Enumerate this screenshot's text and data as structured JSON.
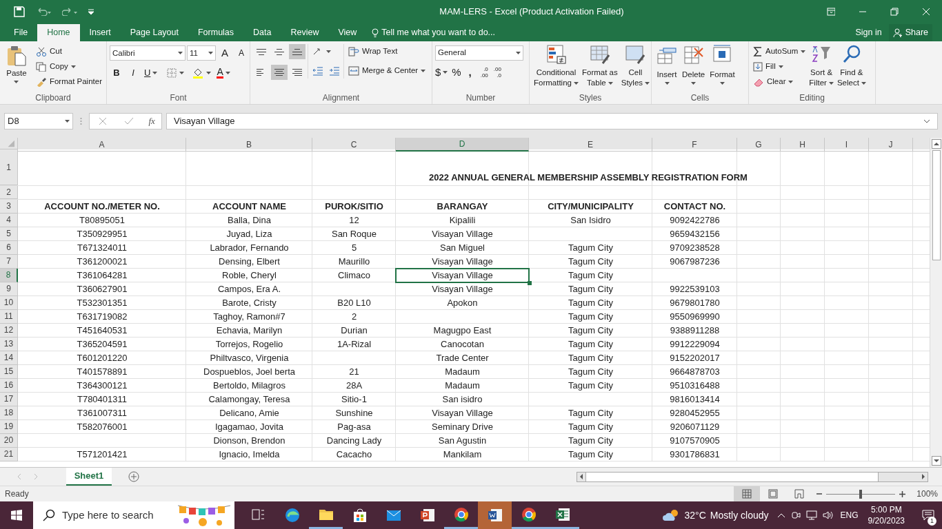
{
  "window": {
    "title": "MAM-LERS - Excel (Product Activation Failed)"
  },
  "ribbon_tabs": [
    {
      "label": "File",
      "selected": false
    },
    {
      "label": "Home",
      "selected": true
    },
    {
      "label": "Insert",
      "selected": false
    },
    {
      "label": "Page Layout",
      "selected": false
    },
    {
      "label": "Formulas",
      "selected": false
    },
    {
      "label": "Data",
      "selected": false
    },
    {
      "label": "Review",
      "selected": false
    },
    {
      "label": "View",
      "selected": false
    }
  ],
  "tell_me": {
    "placeholder": "Tell me what you want to do..."
  },
  "sign_in": "Sign in",
  "share": "Share",
  "clipboard": {
    "label": "Clipboard",
    "paste": "Paste",
    "cut": "Cut",
    "copy": "Copy",
    "format_painter": "Format Painter"
  },
  "font": {
    "label": "Font",
    "name": "Calibri",
    "size": "11",
    "grow": "A",
    "shrink": "A",
    "bold": "B",
    "italic": "I",
    "underline": "U",
    "font_color_label": "A"
  },
  "alignment": {
    "label": "Alignment",
    "vertical": [
      {
        "kind": "top",
        "selected": false
      },
      {
        "kind": "middle",
        "selected": false
      },
      {
        "kind": "bottom",
        "selected": true
      }
    ],
    "horizontal": [
      {
        "kind": "left",
        "selected": false
      },
      {
        "kind": "center",
        "selected": true
      },
      {
        "kind": "right",
        "selected": false
      }
    ],
    "wrap_text": "Wrap Text",
    "merge_center": "Merge & Center"
  },
  "number": {
    "label": "Number",
    "format": "General",
    "currency": "$",
    "percent": "%",
    "comma": ",",
    "increase_decimal": [
      ".0",
      ".00"
    ],
    "decrease_decimal": [
      ".00",
      ".0"
    ]
  },
  "styles": {
    "label": "Styles",
    "buttons": [
      {
        "kind": "conditional",
        "lines": [
          "Conditional",
          "Formatting"
        ]
      },
      {
        "kind": "table",
        "lines": [
          "Format as",
          "Table"
        ]
      },
      {
        "kind": "cell",
        "lines": [
          "Cell",
          "Styles"
        ]
      }
    ]
  },
  "cells": {
    "label": "Cells",
    "buttons": [
      {
        "kind": "insert",
        "label": "Insert"
      },
      {
        "kind": "delete",
        "label": "Delete"
      },
      {
        "kind": "format",
        "label": "Format"
      }
    ]
  },
  "editing": {
    "label": "Editing",
    "autosum": "AutoSum",
    "fill": "Fill",
    "clear": "Clear",
    "sort": [
      "Sort &",
      "Filter"
    ],
    "find": [
      "Find &",
      "Select"
    ]
  },
  "formula_bar": {
    "name_box": "D8",
    "fx": "fx",
    "value": "Visayan Village"
  },
  "columns": [
    {
      "label": "A",
      "selected": false
    },
    {
      "label": "B",
      "selected": false
    },
    {
      "label": "C",
      "selected": false
    },
    {
      "label": "D",
      "selected": true
    },
    {
      "label": "E",
      "selected": false
    },
    {
      "label": "F",
      "selected": false
    },
    {
      "label": "G",
      "selected": false
    },
    {
      "label": "H",
      "selected": false
    },
    {
      "label": "I",
      "selected": false
    },
    {
      "label": "J",
      "selected": false
    }
  ],
  "rows": [
    {
      "number": "1",
      "kind": "title",
      "selected": false,
      "D": "2022 ANNUAL GENERAL MEMBERSHIP ASSEMBLY REGISTRATION FORM"
    },
    {
      "number": "2",
      "kind": "data",
      "selected": false
    },
    {
      "number": "3",
      "kind": "header",
      "selected": false,
      "A": "ACCOUNT NO./METER NO.",
      "B": "ACCOUNT NAME",
      "C": "PUROK/SITIO",
      "D": "BARANGAY",
      "E": "CITY/MUNICIPALITY",
      "F": "CONTACT NO."
    },
    {
      "number": "4",
      "kind": "data",
      "selected": false,
      "A": "T80895051",
      "B": "Balla, Dina",
      "C": "12",
      "D": "Kipalili",
      "E": "San Isidro",
      "F": "9092422786"
    },
    {
      "number": "5",
      "kind": "data",
      "selected": false,
      "A": "T350929951",
      "B": "Juyad, Liza",
      "C": "San Roque",
      "D": "Visayan Village",
      "F": "9659432156"
    },
    {
      "number": "6",
      "kind": "data",
      "selected": false,
      "A": "T671324011",
      "B": "Labrador, Fernando",
      "C": "5",
      "D": "San Miguel",
      "E": "Tagum City",
      "F": "9709238528"
    },
    {
      "number": "7",
      "kind": "data",
      "selected": false,
      "A": "T361200021",
      "B": "Densing, Elbert",
      "C": "Maurillo",
      "D": "Visayan Village",
      "E": "Tagum City",
      "F": "9067987236"
    },
    {
      "number": "8",
      "kind": "data",
      "selected": true,
      "A": "T361064281",
      "B": "Roble, Cheryl",
      "C": "Climaco",
      "D": "Visayan Village",
      "E": "Tagum City"
    },
    {
      "number": "9",
      "kind": "data",
      "selected": false,
      "A": "T360627901",
      "B": "Campos, Era A.",
      "D": "Visayan Village",
      "E": "Tagum City",
      "F": "9922539103"
    },
    {
      "number": "10",
      "kind": "data",
      "selected": false,
      "A": "T532301351",
      "B": "Barote, Cristy",
      "C": "B20 L10",
      "D": "Apokon",
      "E": "Tagum City",
      "F": "9679801780"
    },
    {
      "number": "11",
      "kind": "data",
      "selected": false,
      "A": "T631719082",
      "B": "Taghoy, Ramon#7",
      "C": "2",
      "E": "Tagum City",
      "F": "9550969990"
    },
    {
      "number": "12",
      "kind": "data",
      "selected": false,
      "A": "T451640531",
      "B": "Echavia, Marilyn",
      "C": "Durian",
      "D": "Magugpo East",
      "E": "Tagum City",
      "F": "9388911288"
    },
    {
      "number": "13",
      "kind": "data",
      "selected": false,
      "A": "T365204591",
      "B": "Torrejos, Rogelio",
      "C": "1A-Rizal",
      "D": "Canocotan",
      "E": "Tagum City",
      "F": "9912229094"
    },
    {
      "number": "14",
      "kind": "data",
      "selected": false,
      "A": "T601201220",
      "B": "Philtvasco, Virgenia",
      "D": "Trade Center",
      "E": "Tagum City",
      "F": "9152202017"
    },
    {
      "number": "15",
      "kind": "data",
      "selected": false,
      "A": "T401578891",
      "B": "Dospueblos, Joel berta",
      "C": "21",
      "D": "Madaum",
      "E": "Tagum City",
      "F": "9664878703"
    },
    {
      "number": "16",
      "kind": "data",
      "selected": false,
      "A": "T364300121",
      "B": "Bertoldo, Milagros",
      "C": "28A",
      "D": "Madaum",
      "E": "Tagum City",
      "F": "9510316488"
    },
    {
      "number": "17",
      "kind": "data",
      "selected": false,
      "A": "T780401311",
      "B": "Calamongay, Teresa",
      "C": "Sitio-1",
      "D": "San isidro",
      "F": "9816013414"
    },
    {
      "number": "18",
      "kind": "data",
      "selected": false,
      "A": "T361007311",
      "B": "Delicano, Amie",
      "C": "Sunshine",
      "D": "Visayan Village",
      "E": "Tagum City",
      "F": "9280452955"
    },
    {
      "number": "19",
      "kind": "data",
      "selected": false,
      "A": "T582076001",
      "B": "Igagamao, Jovita",
      "C": "Pag-asa",
      "D": "Seminary Drive",
      "E": "Tagum City",
      "F": "9206071129"
    },
    {
      "number": "20",
      "kind": "data",
      "selected": false,
      "B": "Dionson, Brendon",
      "C": "Dancing Lady",
      "D": "San Agustin",
      "E": "Tagum City",
      "F": "9107570905"
    },
    {
      "number": "21",
      "kind": "data",
      "selected": false,
      "A": "T571201421",
      "B": "Ignacio, Imelda",
      "C": "Cacacho",
      "D": "Mankilam",
      "E": "Tagum City",
      "F": "9301786831"
    }
  ],
  "sheet_tabs": [
    {
      "label": "Sheet1",
      "selected": true
    }
  ],
  "status_bar": {
    "ready": "Ready",
    "views": [
      {
        "kind": "normal",
        "selected": true
      },
      {
        "kind": "page_layout",
        "selected": false
      },
      {
        "kind": "page_break",
        "selected": false
      }
    ],
    "zoom": {
      "level": 0.5,
      "reading": "100%"
    }
  },
  "taskbar": {
    "search": {
      "placeholder": "Type here to search"
    },
    "apps": [
      {
        "kind": "taskview",
        "selected": false,
        "running": false
      },
      {
        "kind": "edge",
        "selected": false,
        "running": false
      },
      {
        "kind": "explorer",
        "selected": false,
        "running": true
      },
      {
        "kind": "store",
        "selected": false,
        "running": false
      },
      {
        "kind": "mail",
        "selected": false,
        "running": false
      },
      {
        "kind": "powerpoint",
        "selected": false,
        "running": false
      },
      {
        "kind": "chrome",
        "selected": false,
        "running": true
      },
      {
        "kind": "word",
        "selected": true,
        "running": false
      },
      {
        "kind": "chrome",
        "selected": false,
        "running": true
      },
      {
        "kind": "excel",
        "selected": false,
        "running": true
      }
    ],
    "temperature": "32°C",
    "weather": "Mostly cloudy",
    "language": "ENG",
    "time": "5:00 PM",
    "date": "9/20/2023",
    "notifications": "1"
  }
}
